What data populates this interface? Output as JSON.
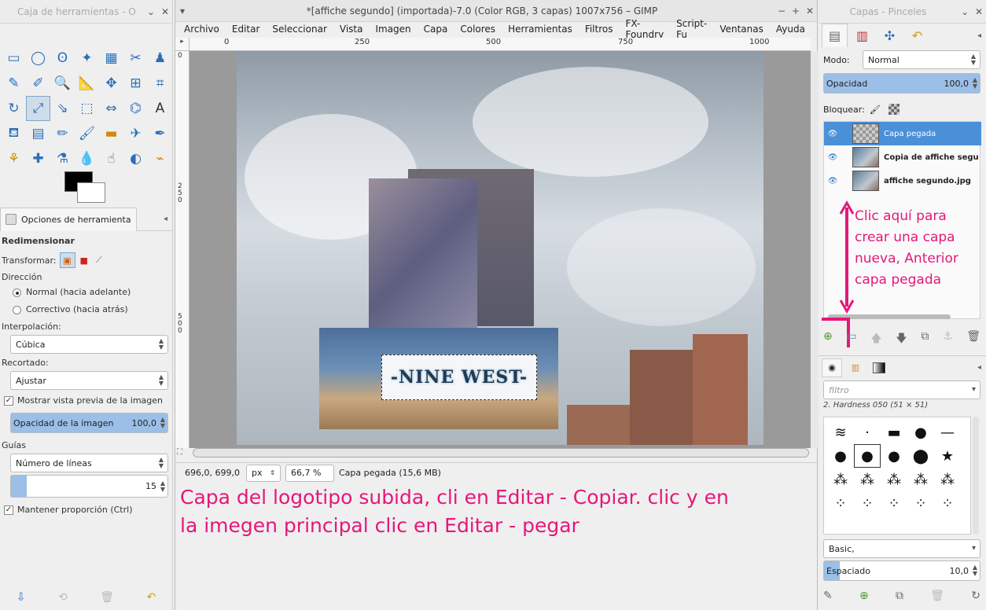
{
  "toolbox": {
    "title": "Caja de herramientas - O",
    "tools": [
      "rect-select-icon",
      "ellipse-select-icon",
      "free-select-icon",
      "fuzzy-select-icon",
      "color-select-icon",
      "scissors-icon",
      "foreground-select-icon",
      "paths-icon",
      "color-picker-icon",
      "zoom-icon",
      "measure-icon",
      "move-icon",
      "align-icon",
      "crop-icon",
      "rotate-icon",
      "scale-icon",
      "shear-icon",
      "perspective-icon",
      "flip-icon",
      "cage-icon",
      "text-icon",
      "bucket-fill-icon",
      "blend-icon",
      "pencil-icon",
      "paintbrush-icon",
      "eraser-icon",
      "airbrush-icon",
      "ink-icon",
      "clone-icon",
      "heal-icon",
      "perspective-clone-icon",
      "blur-icon",
      "smudge-icon",
      "dodge-burn-icon",
      "warp-icon"
    ],
    "tool_glyphs": [
      "▭",
      "◯",
      "ʘ",
      "✦",
      "▦",
      "✂",
      "♟",
      "✎",
      "✐",
      "🔍",
      "📐",
      "✥",
      "⊞",
      "⌗",
      "↻",
      "⤢",
      "⇘",
      "⬚",
      "⇔",
      "⌬",
      "A",
      "⛾",
      "▤",
      "✏",
      "🖌",
      "▬",
      "✈",
      "✒",
      "⚘",
      "✚",
      "⚗",
      "💧",
      "☝",
      "◐",
      "⌁"
    ],
    "options_tab": "Opciones de herramienta",
    "tool_name": "Redimensionar",
    "transform_label": "Transformar:",
    "direction_label": "Dirección",
    "direction_normal": "Normal (hacia adelante)",
    "direction_corrective": "Correctivo (hacia atrás)",
    "interp_label": "Interpolación:",
    "interp_value": "Cúbica",
    "clip_label": "Recortado:",
    "clip_value": "Ajustar",
    "preview_label": "Mostrar vista previa de la imagen",
    "opacity_label": "Opacidad de la imagen",
    "opacity_value": "100,0",
    "opacity_fraction": 1.0,
    "guides_label": "Guías",
    "guides_value": "Número de líneas",
    "lines_value": "15",
    "keep_ratio_label": "Mantener proporción  (Ctrl)"
  },
  "image_window": {
    "title": "*[affiche segundo] (importada)-7.0 (Color RGB, 3 capas) 1007x756 – GIMP",
    "menu": [
      "Archivo",
      "Editar",
      "Seleccionar",
      "Vista",
      "Imagen",
      "Capa",
      "Colores",
      "Herramientas",
      "Filtros",
      "FX-Foundry",
      "Script-Fu",
      "Ventanas",
      "Ayuda"
    ],
    "ruler_h": [
      "0",
      "250",
      "500",
      "750",
      "1000"
    ],
    "ruler_v": [
      "0",
      "250",
      "500"
    ],
    "logo_text": "-NINE WEST-",
    "status": {
      "coords": "696,0, 699,0",
      "unit": "px",
      "zoom": "66,7 %",
      "layer_info": "Capa pegada (15,6 MB)"
    }
  },
  "annotations": {
    "main_line1": "Capa del logotipo subida, cli en Editar - Copiar. clic y en",
    "main_line2": "la  imegen principal clic en Editar -  pegar",
    "side": [
      "Clic aquí para",
      "crear una capa",
      "nueva, Anterior",
      "capa pegada"
    ]
  },
  "dock": {
    "title": "Capas - Pinceles",
    "mode_label": "Modo:",
    "mode_value": "Normal",
    "opacity_label": "Opacidad",
    "opacity_value": "100,0",
    "opacity_fraction": 1.0,
    "lock_label": "Bloquear:",
    "layers": [
      {
        "name": "Capa pegada",
        "selected": true
      },
      {
        "name": "Copia de affiche segu",
        "selected": false
      },
      {
        "name": "affiche segundo.jpg",
        "selected": false
      }
    ],
    "filter_placeholder": "filtro",
    "brush_name": "2. Hardness 050 (51 × 51)",
    "brush_glyphs": [
      "≋",
      "·",
      "▬",
      "●",
      "—",
      "●",
      "●",
      "●",
      "⬤",
      "★",
      "⁂",
      "⁂",
      "⁂",
      "⁂",
      "⁂",
      "⁘",
      "⁘",
      "⁘",
      "⁘",
      "⁘"
    ],
    "brush_set": "Basic,",
    "spacing_label": "Espaciado",
    "spacing_value": "10,0",
    "spacing_fraction": 0.1
  },
  "colors": {
    "accent": "#4a90d9",
    "annotation": "#e6177a"
  }
}
